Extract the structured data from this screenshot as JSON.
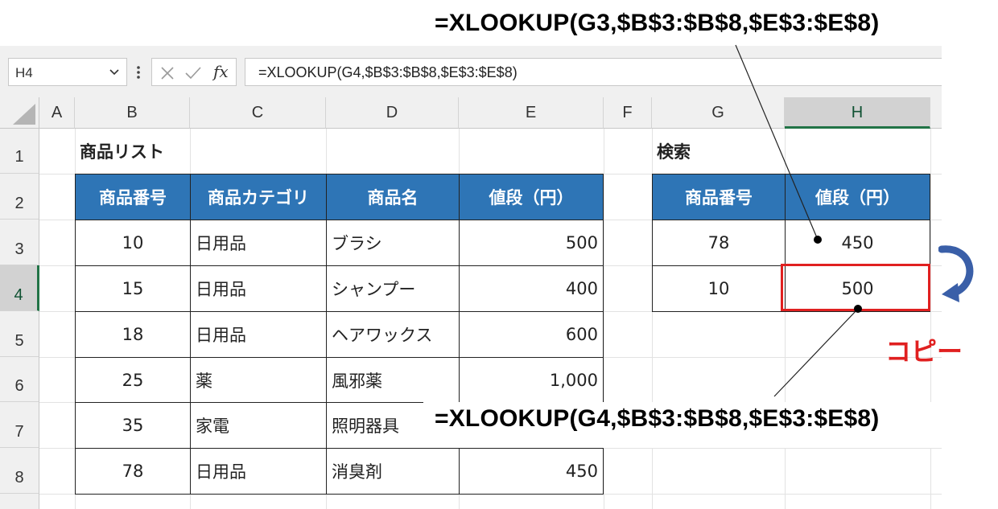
{
  "annotation_top": "=XLOOKUP(G3,$B$3:$B$8,$E$3:$E$8)",
  "annotation_bottom": "=XLOOKUP(G4,$B$3:$B$8,$E$3:$E$8)",
  "copy_label": "コピー",
  "name_box": "H4",
  "formula_bar": "=XLOOKUP(G4,$B$3:$B$8,$E$3:$E$8)",
  "fx_label": "fx",
  "columns": [
    "A",
    "B",
    "C",
    "D",
    "E",
    "F",
    "G",
    "H"
  ],
  "rows": [
    "1",
    "2",
    "3",
    "4",
    "5",
    "6",
    "7",
    "8"
  ],
  "product_list": {
    "title": "商品リスト",
    "headers": [
      "商品番号",
      "商品カテゴリ",
      "商品名",
      "値段（円）"
    ],
    "rows": [
      [
        "10",
        "日用品",
        "ブラシ",
        "500"
      ],
      [
        "15",
        "日用品",
        "シャンプー",
        "400"
      ],
      [
        "18",
        "日用品",
        "ヘアワックス",
        "600"
      ],
      [
        "25",
        "薬",
        "風邪薬",
        "1,000"
      ],
      [
        "35",
        "家電",
        "照明器具",
        ""
      ],
      [
        "78",
        "日用品",
        "消臭剤",
        "450"
      ]
    ]
  },
  "search": {
    "title": "検索",
    "headers": [
      "商品番号",
      "値段（円）"
    ],
    "rows": [
      [
        "78",
        "450"
      ],
      [
        "10",
        "500"
      ]
    ]
  },
  "colors": {
    "header_fill": "#2e75b6",
    "highlight": "#e02020",
    "arrow": "#3a5fa8",
    "selected": "#217346"
  }
}
